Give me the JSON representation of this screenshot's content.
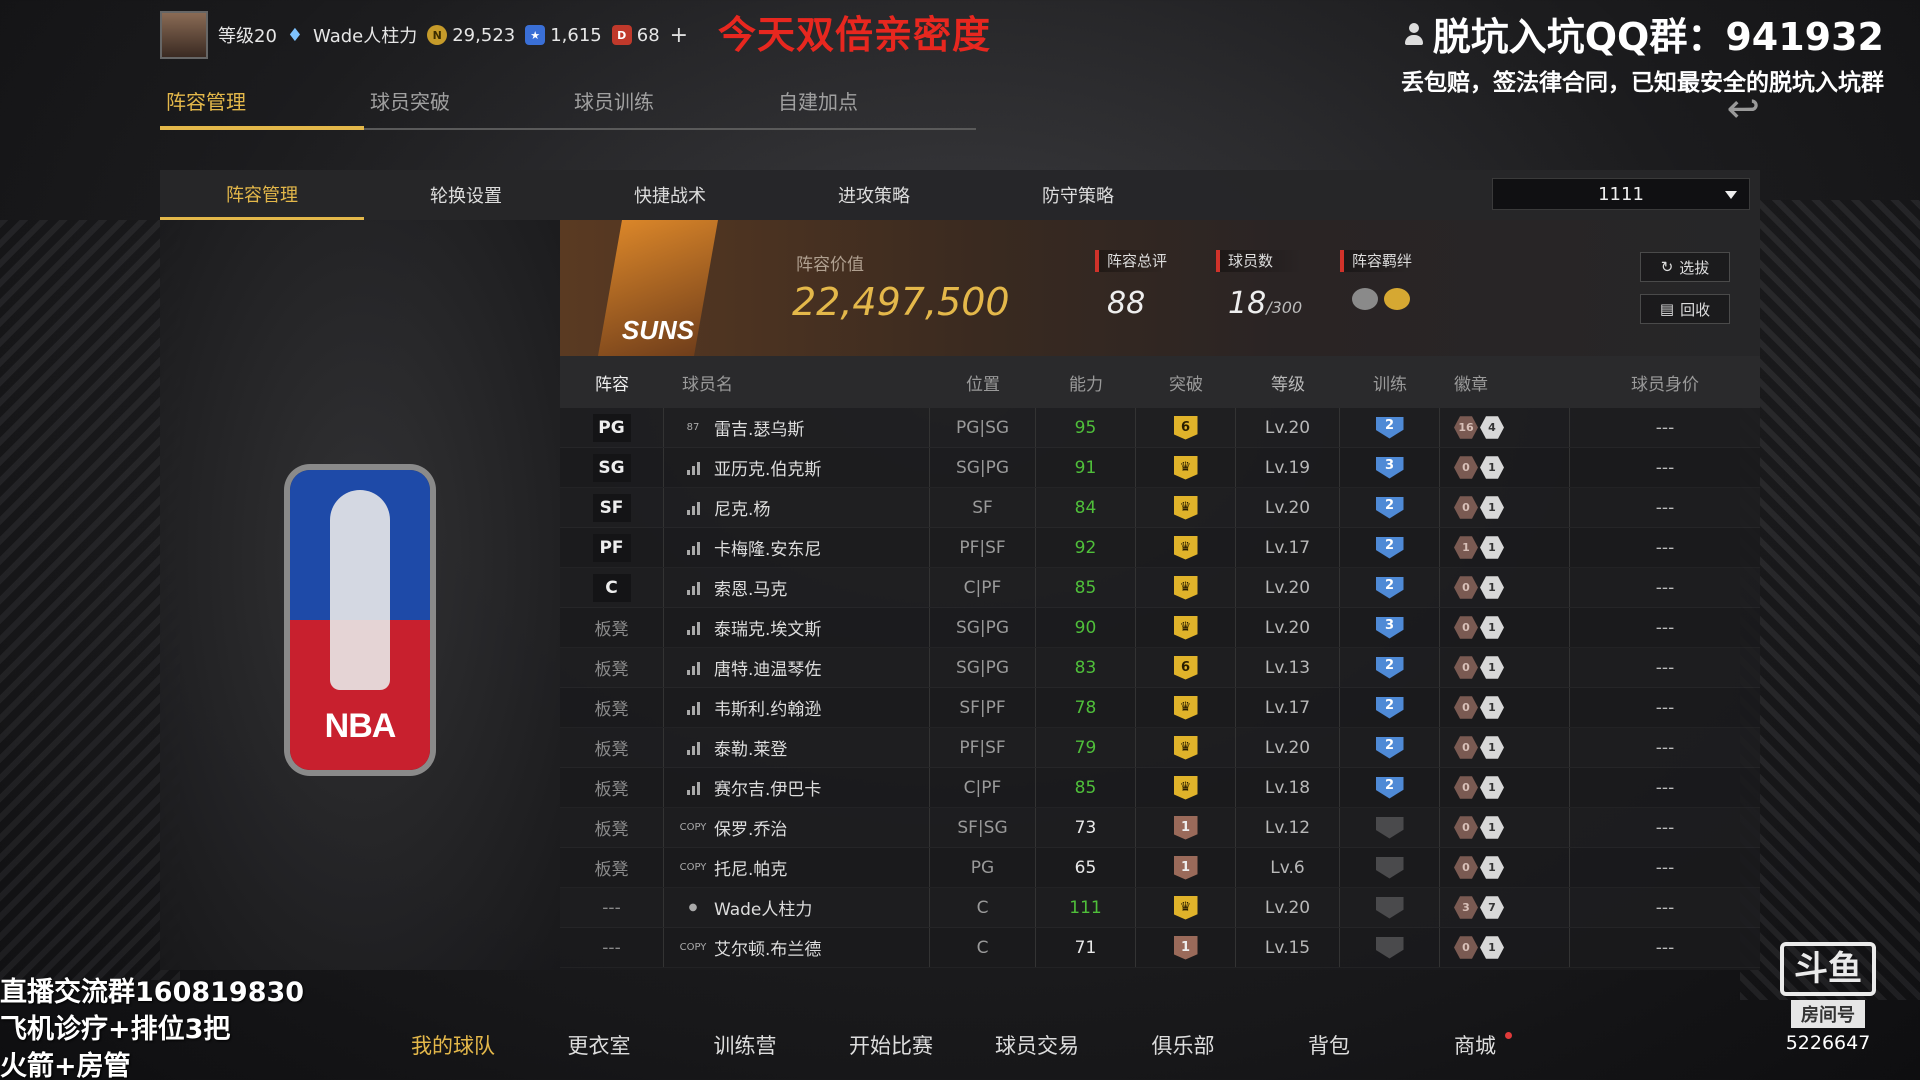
{
  "topbar": {
    "level": "等级20",
    "player_name": "Wade人柱力",
    "coins": "29,523",
    "stars": "1,615",
    "tickets": "68",
    "plus": "+"
  },
  "promo_text": "今天双倍亲密度",
  "overlay": {
    "qq_line": "脱坑入坑QQ群：941932",
    "qq_sub": "丢包赔，签法律合同，已知最安全的脱坑入坑群",
    "stream_lines": [
      "直播交流群160819830",
      "飞机诊疗+排位3把",
      "火箭+房管"
    ],
    "douyu_logo": "斗鱼",
    "douyu_room_label": "房间号",
    "douyu_room": "5226647"
  },
  "main_tabs": [
    "阵容管理",
    "球员突破",
    "球员训练",
    "自建加点"
  ],
  "sub_tabs": [
    "阵容管理",
    "轮换设置",
    "快捷战术",
    "进攻策略",
    "防守策略"
  ],
  "lineup_select": "1111",
  "nba_logo_text": "NBA",
  "team_badge_text": "SUNS",
  "summary": {
    "value_label": "阵容价值",
    "value": "22,497,500",
    "rating_label": "阵容总评",
    "rating": "88",
    "count_label": "球员数",
    "count": "18",
    "count_max": "/300",
    "bond_label": "阵容羁绊",
    "select_btn": "选拔",
    "recycle_btn": "回收"
  },
  "table": {
    "headers": [
      "阵容",
      "球员名",
      "位置",
      "能力",
      "突破",
      "等级",
      "训练",
      "徽章",
      "球员身价"
    ],
    "rows": [
      {
        "slot": "PG",
        "starter": true,
        "icon": "87",
        "name": "雷吉.瑟乌斯",
        "role": "PG|SG",
        "ovr": "95",
        "green": true,
        "brk": "6",
        "brk_low": false,
        "lvl": "Lv.20",
        "trn": "2",
        "b1": "16",
        "b2": "4",
        "val": "---"
      },
      {
        "slot": "SG",
        "starter": true,
        "icon": "bars",
        "name": "亚历克.伯克斯",
        "role": "SG|PG",
        "ovr": "91",
        "green": true,
        "brk": "",
        "brk_low": false,
        "lvl": "Lv.19",
        "trn": "3",
        "b1": "0",
        "b2": "1",
        "val": "---"
      },
      {
        "slot": "SF",
        "starter": true,
        "icon": "bars",
        "name": "尼克.杨",
        "role": "SF",
        "ovr": "84",
        "green": true,
        "brk": "",
        "brk_low": false,
        "lvl": "Lv.20",
        "trn": "2",
        "b1": "0",
        "b2": "1",
        "val": "---"
      },
      {
        "slot": "PF",
        "starter": true,
        "icon": "bars",
        "name": "卡梅隆.安东尼",
        "role": "PF|SF",
        "ovr": "92",
        "green": true,
        "brk": "",
        "brk_low": false,
        "lvl": "Lv.17",
        "trn": "2",
        "b1": "1",
        "b2": "1",
        "val": "---"
      },
      {
        "slot": "C",
        "starter": true,
        "icon": "bars",
        "name": "索恩.马克",
        "role": "C|PF",
        "ovr": "85",
        "green": true,
        "brk": "",
        "brk_low": false,
        "lvl": "Lv.20",
        "trn": "2",
        "b1": "0",
        "b2": "1",
        "val": "---"
      },
      {
        "slot": "板凳",
        "starter": false,
        "icon": "bars",
        "name": "泰瑞克.埃文斯",
        "role": "SG|PG",
        "ovr": "90",
        "green": true,
        "brk": "",
        "brk_low": false,
        "lvl": "Lv.20",
        "trn": "3",
        "b1": "0",
        "b2": "1",
        "val": "---"
      },
      {
        "slot": "板凳",
        "starter": false,
        "icon": "bars",
        "name": "唐特.迪温琴佐",
        "role": "SG|PG",
        "ovr": "83",
        "green": true,
        "brk": "6",
        "brk_low": false,
        "lvl": "Lv.13",
        "trn": "2",
        "b1": "0",
        "b2": "1",
        "val": "---"
      },
      {
        "slot": "板凳",
        "starter": false,
        "icon": "bars",
        "name": "韦斯利.约翰逊",
        "role": "SF|PF",
        "ovr": "78",
        "green": true,
        "brk": "",
        "brk_low": false,
        "lvl": "Lv.17",
        "trn": "2",
        "b1": "0",
        "b2": "1",
        "val": "---"
      },
      {
        "slot": "板凳",
        "starter": false,
        "icon": "bars",
        "name": "泰勒.莱登",
        "role": "PF|SF",
        "ovr": "79",
        "green": true,
        "brk": "",
        "brk_low": false,
        "lvl": "Lv.20",
        "trn": "2",
        "b1": "0",
        "b2": "1",
        "val": "---"
      },
      {
        "slot": "板凳",
        "starter": false,
        "icon": "bars",
        "name": "赛尔吉.伊巴卡",
        "role": "C|PF",
        "ovr": "85",
        "green": true,
        "brk": "",
        "brk_low": false,
        "lvl": "Lv.18",
        "trn": "2",
        "b1": "0",
        "b2": "1",
        "val": "---"
      },
      {
        "slot": "板凳",
        "starter": false,
        "icon": "COPY",
        "name": "保罗.乔治",
        "role": "SF|SG",
        "ovr": "73",
        "green": false,
        "brk": "1",
        "brk_low": true,
        "lvl": "Lv.12",
        "trn": "",
        "b1": "0",
        "b2": "1",
        "val": "---"
      },
      {
        "slot": "板凳",
        "starter": false,
        "icon": "COPY",
        "name": "托尼.帕克",
        "role": "PG",
        "ovr": "65",
        "green": false,
        "brk": "1",
        "brk_low": true,
        "lvl": "Lv.6",
        "trn": "",
        "b1": "0",
        "b2": "1",
        "val": "---"
      },
      {
        "slot": "---",
        "starter": false,
        "icon": "person",
        "name": "Wade人柱力",
        "role": "C",
        "ovr": "111",
        "green": true,
        "brk": "",
        "brk_low": false,
        "lvl": "Lv.20",
        "trn": "",
        "b1": "3",
        "b2": "7",
        "val": "---"
      },
      {
        "slot": "---",
        "starter": false,
        "icon": "COPY",
        "name": "艾尔顿.布兰德",
        "role": "C",
        "ovr": "71",
        "green": false,
        "brk": "1",
        "brk_low": true,
        "lvl": "Lv.15",
        "trn": "",
        "b1": "0",
        "b2": "1",
        "val": "---"
      }
    ]
  },
  "bottom_nav": [
    "我的球队",
    "更衣室",
    "训练营",
    "开始比赛",
    "球员交易",
    "俱乐部",
    "背包",
    "商城"
  ],
  "colors": {
    "accent": "#e4b84a",
    "promo": "#e8271f",
    "ovr_green": "#4fbf3a",
    "train_blue": "#4f8ad6"
  }
}
